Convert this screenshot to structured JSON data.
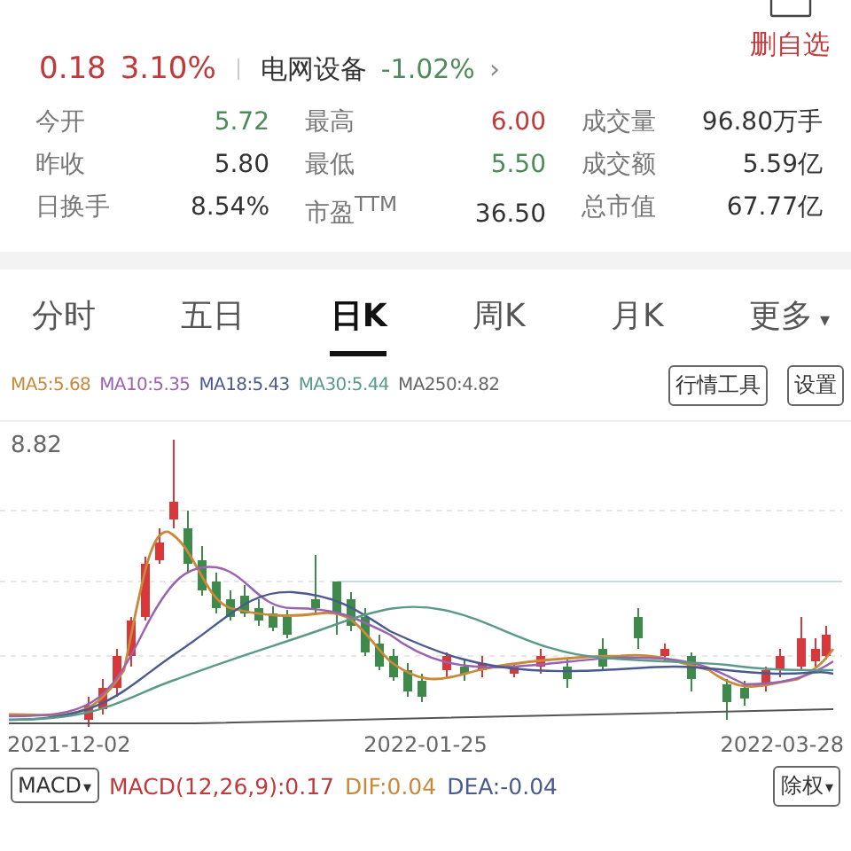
{
  "header": {
    "change": "0.18",
    "change_pct": "3.10%",
    "sector": "电网设备",
    "sector_change": "-1.02%",
    "sector_arrow": "›",
    "watch_button": "删自选"
  },
  "stats": [
    {
      "label": "今开",
      "value": "5.72",
      "color": "#4f8a5a"
    },
    {
      "label": "最高",
      "value": "6.00",
      "color": "#c0393b"
    },
    {
      "label": "成交量",
      "value": "96.80万手",
      "color": "#333333"
    },
    {
      "label": "昨收",
      "value": "5.80",
      "color": "#333333"
    },
    {
      "label": "最低",
      "value": "5.50",
      "color": "#4f8a5a"
    },
    {
      "label": "成交额",
      "value": "5.59亿",
      "color": "#333333"
    },
    {
      "label": "日换手",
      "value": "8.54%",
      "color": "#333333"
    },
    {
      "label": "市盈$^{TTM}$",
      "value": "36.50",
      "color": "#333333"
    },
    {
      "label": "总市值",
      "value": "67.77亿",
      "color": "#333333"
    }
  ],
  "tabs": [
    {
      "label": "分时",
      "selected": false
    },
    {
      "label": "五日",
      "selected": false
    },
    {
      "label": "日K",
      "selected": true
    },
    {
      "label": "周K",
      "selected": false
    },
    {
      "label": "月K",
      "selected": false
    },
    {
      "label": "更多",
      "selected": false,
      "caret": "▾"
    }
  ],
  "ma_legend": [
    {
      "text": "MA5:5.68",
      "color": "#c8893a"
    },
    {
      "text": "MA10:5.35",
      "color": "#9a62b0"
    },
    {
      "text": "MA18:5.43",
      "color": "#4a5a8e"
    },
    {
      "text": "MA30:5.44",
      "color": "#5a9a88"
    },
    {
      "text": "MA250:4.82",
      "color": "#666666"
    }
  ],
  "tool_buttons": [
    "行情工具",
    "设置"
  ],
  "chart": {
    "top_label": "8.82",
    "dates": [
      "2021-12-02",
      "2022-01-25",
      "2022-03-28"
    ]
  },
  "indicator": {
    "selector": "MACD",
    "caret": "▾",
    "macd": "MACD(12,26,9):0.17",
    "dif": "DIF:0.04",
    "dea": "DEA:-0.04",
    "adjust": "除权",
    "adjust_caret": "▾"
  }
}
